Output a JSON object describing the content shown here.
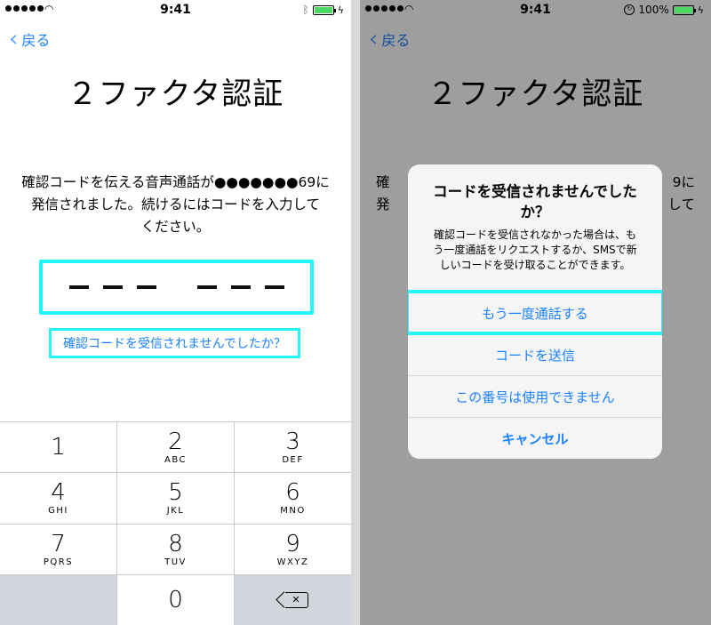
{
  "status": {
    "time": "9:41",
    "battery_pct": "100%"
  },
  "left": {
    "back_label": "戻る",
    "title": "２ファクタ認証",
    "description_line1": "確認コードを伝える音声通話が●●●●●●●69に",
    "description_line2": "発信されました。続けるにはコードを入力して",
    "description_line3": "ください。",
    "code_placeholder": "– – –   – – –",
    "link_label": "確認コードを受信されませんでしたか？",
    "keypad": [
      {
        "num": "1",
        "letters": ""
      },
      {
        "num": "2",
        "letters": "ABC"
      },
      {
        "num": "3",
        "letters": "DEF"
      },
      {
        "num": "4",
        "letters": "GHI"
      },
      {
        "num": "5",
        "letters": "JKL"
      },
      {
        "num": "6",
        "letters": "MNO"
      },
      {
        "num": "7",
        "letters": "PQRS"
      },
      {
        "num": "8",
        "letters": "TUV"
      },
      {
        "num": "9",
        "letters": "WXYZ"
      },
      {
        "num": "0",
        "letters": ""
      }
    ]
  },
  "right": {
    "back_label": "戻る",
    "title": "２ファクタ認証",
    "bg_desc_line1": "確",
    "bg_desc_line1_end": "9に",
    "bg_desc_line2": "発",
    "bg_desc_line2_end": "して",
    "alert": {
      "title_line1": "コードを受信されませんでした",
      "title_line2": "か？",
      "message_line1": "確認コードを受信されなかった場合は、も",
      "message_line2": "う一度通話をリクエストするか、SMSで新",
      "message_line3": "しいコードを受け取ることができます。",
      "buttons": {
        "call_again": "もう一度通話する",
        "send_code": "コードを送信",
        "unavailable": "この番号は使用できません",
        "cancel": "キャンセル"
      }
    }
  },
  "colors": {
    "accent": "#1a82fb",
    "highlight": "#22f6fb"
  }
}
